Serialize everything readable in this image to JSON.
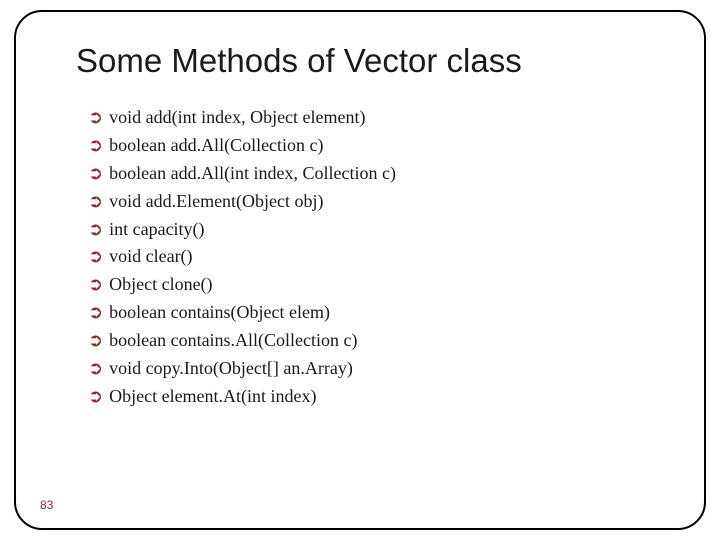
{
  "slide": {
    "title": "Some Methods of Vector class",
    "page_number": "83",
    "methods": [
      "void add(int index, Object element)",
      "boolean add.All(Collection c)",
      "boolean add.All(int index, Collection c)",
      "void add.Element(Object obj)",
      "int capacity()",
      "void clear()",
      "Object clone()",
      "boolean contains(Object elem)",
      "boolean contains.All(Collection c)",
      "void copy.Into(Object[] an.Array)",
      "Object element.At(int index)"
    ]
  }
}
